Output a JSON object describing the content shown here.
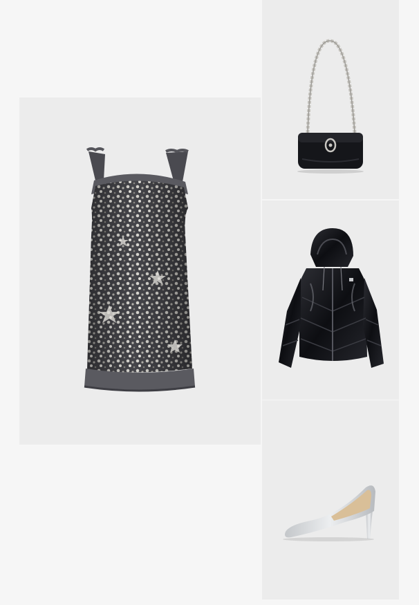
{
  "outfit": {
    "items": [
      {
        "id": "dress",
        "kind": "sequin-mini-dress"
      },
      {
        "id": "bag",
        "kind": "black-shoulder-bag-with-chain-strap"
      },
      {
        "id": "jacket",
        "kind": "black-glossy-puffer-jacket"
      },
      {
        "id": "shoe",
        "kind": "silver-glitter-pump"
      }
    ],
    "colors": {
      "page_background": "#f6f6f6",
      "tile_background": "#ececec",
      "dress_base": "#3a3a3e",
      "sequin_silver": "#d8d6d0",
      "bag_black": "#15161a",
      "jacket_black": "#0d0e12",
      "shoe_silver": "#d9dcde"
    }
  }
}
